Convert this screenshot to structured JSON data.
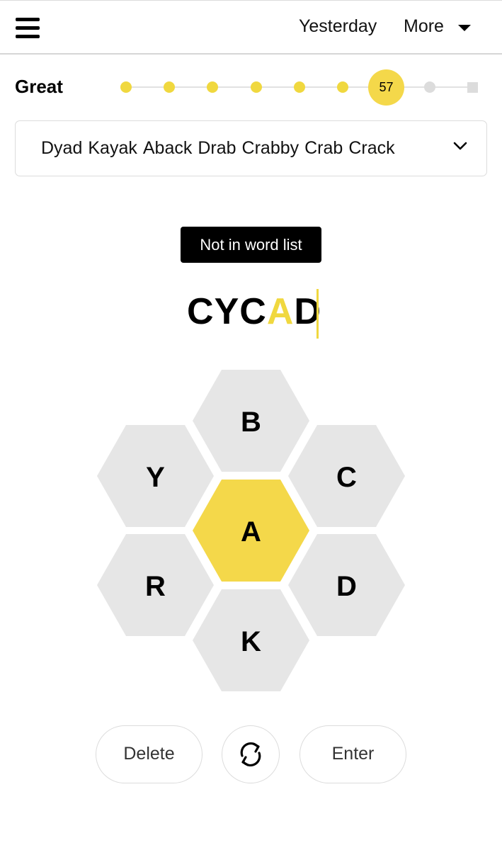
{
  "header": {
    "yesterday_label": "Yesterday",
    "more_label": "More"
  },
  "progress": {
    "rank": "Great",
    "score": "57"
  },
  "found_words": [
    "Dyad",
    "Kayak",
    "Aback",
    "Drab",
    "Crabby",
    "Crab",
    "Crack"
  ],
  "toast": "Not in word list",
  "input": {
    "letters": [
      "C",
      "Y",
      "C",
      "A",
      "D"
    ]
  },
  "hive": {
    "center": "A",
    "top": "B",
    "upper_left": "Y",
    "upper_right": "C",
    "lower_left": "R",
    "lower_right": "D",
    "bottom": "K"
  },
  "buttons": {
    "delete": "Delete",
    "enter": "Enter"
  },
  "colors": {
    "yellow": "#f4d84a",
    "cell_grey": "#e6e6e6"
  }
}
